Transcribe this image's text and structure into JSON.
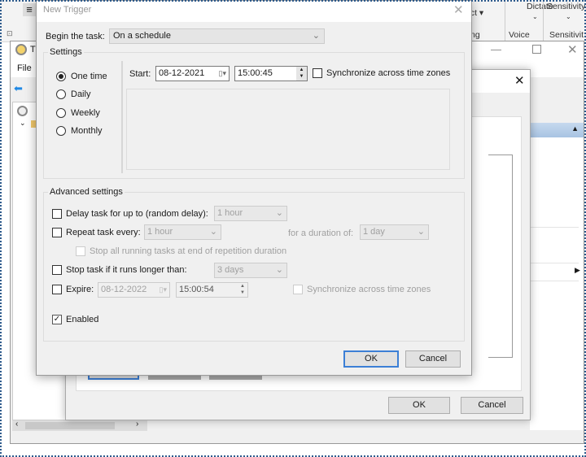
{
  "ribbon": {
    "items": [
      "ect ▾",
      "Dictate",
      "Sensitivity",
      "ng",
      "Voice",
      "Sensitivit"
    ]
  },
  "scheduler": {
    "title_initial": "T",
    "menu_file": "File"
  },
  "props_dialog": {
    "ok": "OK",
    "cancel": "Cancel"
  },
  "trigger": {
    "title": "New Trigger",
    "begin_label": "Begin the task:",
    "begin_value": "On a schedule",
    "settings_label": "Settings",
    "schedule_options": [
      {
        "label": "One time",
        "selected": true
      },
      {
        "label": "Daily",
        "selected": false
      },
      {
        "label": "Weekly",
        "selected": false
      },
      {
        "label": "Monthly",
        "selected": false
      }
    ],
    "start_label": "Start:",
    "start_date": "08-12-2021",
    "start_time": "15:00:45",
    "sync_label": "Synchronize across time zones",
    "advanced_label": "Advanced settings",
    "delay_label": "Delay task for up to (random delay):",
    "delay_value": "1 hour",
    "repeat_label": "Repeat task every:",
    "repeat_value": "1 hour",
    "duration_label": "for a duration of:",
    "duration_value": "1 day",
    "stop_all_label": "Stop all running tasks at end of repetition duration",
    "stop_label": "Stop task if it runs longer than:",
    "stop_value": "3 days",
    "expire_label": "Expire:",
    "expire_date": "08-12-2022",
    "expire_time": "15:00:54",
    "expire_sync_label": "Synchronize across time zones",
    "enabled_label": "Enabled",
    "enabled": true,
    "ok": "OK",
    "cancel": "Cancel"
  }
}
